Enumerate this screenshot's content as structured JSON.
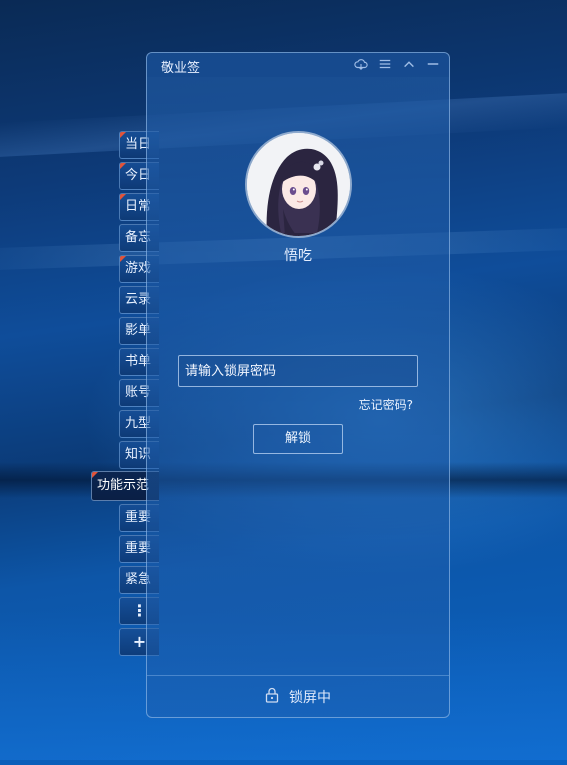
{
  "window": {
    "title": "敬业签",
    "titlebar_icons": [
      "cloud-sync-icon",
      "menu-icon",
      "collapse-icon",
      "minimize-icon"
    ]
  },
  "user": {
    "name": "悟吃"
  },
  "lock": {
    "password_placeholder": "请输入锁屏密码",
    "forgot_label": "忘记密码?",
    "unlock_label": "解锁",
    "status_label": "锁屏中",
    "status_icon": "lock-icon"
  },
  "sidebar": {
    "tabs": [
      {
        "label": "当日",
        "marked": true
      },
      {
        "label": "今日",
        "marked": true
      },
      {
        "label": "日常",
        "marked": true
      },
      {
        "label": "备忘",
        "marked": false
      },
      {
        "label": "游戏",
        "marked": true
      },
      {
        "label": "云录",
        "marked": false
      },
      {
        "label": "影单",
        "marked": false
      },
      {
        "label": "书单",
        "marked": false
      },
      {
        "label": "账号",
        "marked": false
      },
      {
        "label": "九型",
        "marked": false
      },
      {
        "label": "知识",
        "marked": false
      },
      {
        "label": "功能示范",
        "marked": true,
        "active": true
      },
      {
        "label": "重要",
        "marked": false
      },
      {
        "label": "重要",
        "marked": false
      },
      {
        "label": "紧急",
        "marked": false
      }
    ],
    "more_label": "⋮",
    "add_label": "+"
  },
  "colors": {
    "accent_mark": "#e2543a",
    "window_border": "#aacdf5"
  }
}
